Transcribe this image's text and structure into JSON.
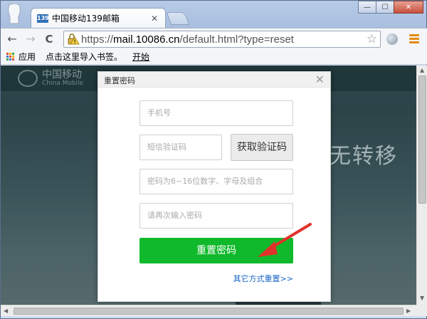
{
  "browser": {
    "tab": {
      "favicon": "139",
      "title": "中国移动139邮箱",
      "close": "✕"
    },
    "window_controls": [
      "—",
      "☐",
      "✕"
    ],
    "nav": {
      "back": "←",
      "forward": "→",
      "reload": "C"
    },
    "url": {
      "scheme": "https://",
      "host": "mail.10086.cn",
      "path": "/default.html?type=reset"
    },
    "star": "☆",
    "bookmarks": [
      {
        "label": "应用"
      },
      {
        "label": "点击这里导入书签。"
      },
      {
        "label": "开始"
      }
    ]
  },
  "site": {
    "logo_cn": "中国移动",
    "logo_en": "China Mobile",
    "bg_slogan": "无转移"
  },
  "modal": {
    "title": "重置密码",
    "close": "✕",
    "phone_placeholder": "手机号",
    "sms_placeholder": "短信验证码",
    "get_code_label": "获取验证码",
    "password_placeholder": "密码为6~16位数字、字母及组合",
    "confirm_placeholder": "请再次输入密码",
    "submit_label": "重置密码",
    "alt_link": "其它方式重置>>"
  },
  "colors": {
    "submit_green": "#10b92b",
    "link_blue": "#1a66c8",
    "annotation_arrow": "#e0322b"
  }
}
